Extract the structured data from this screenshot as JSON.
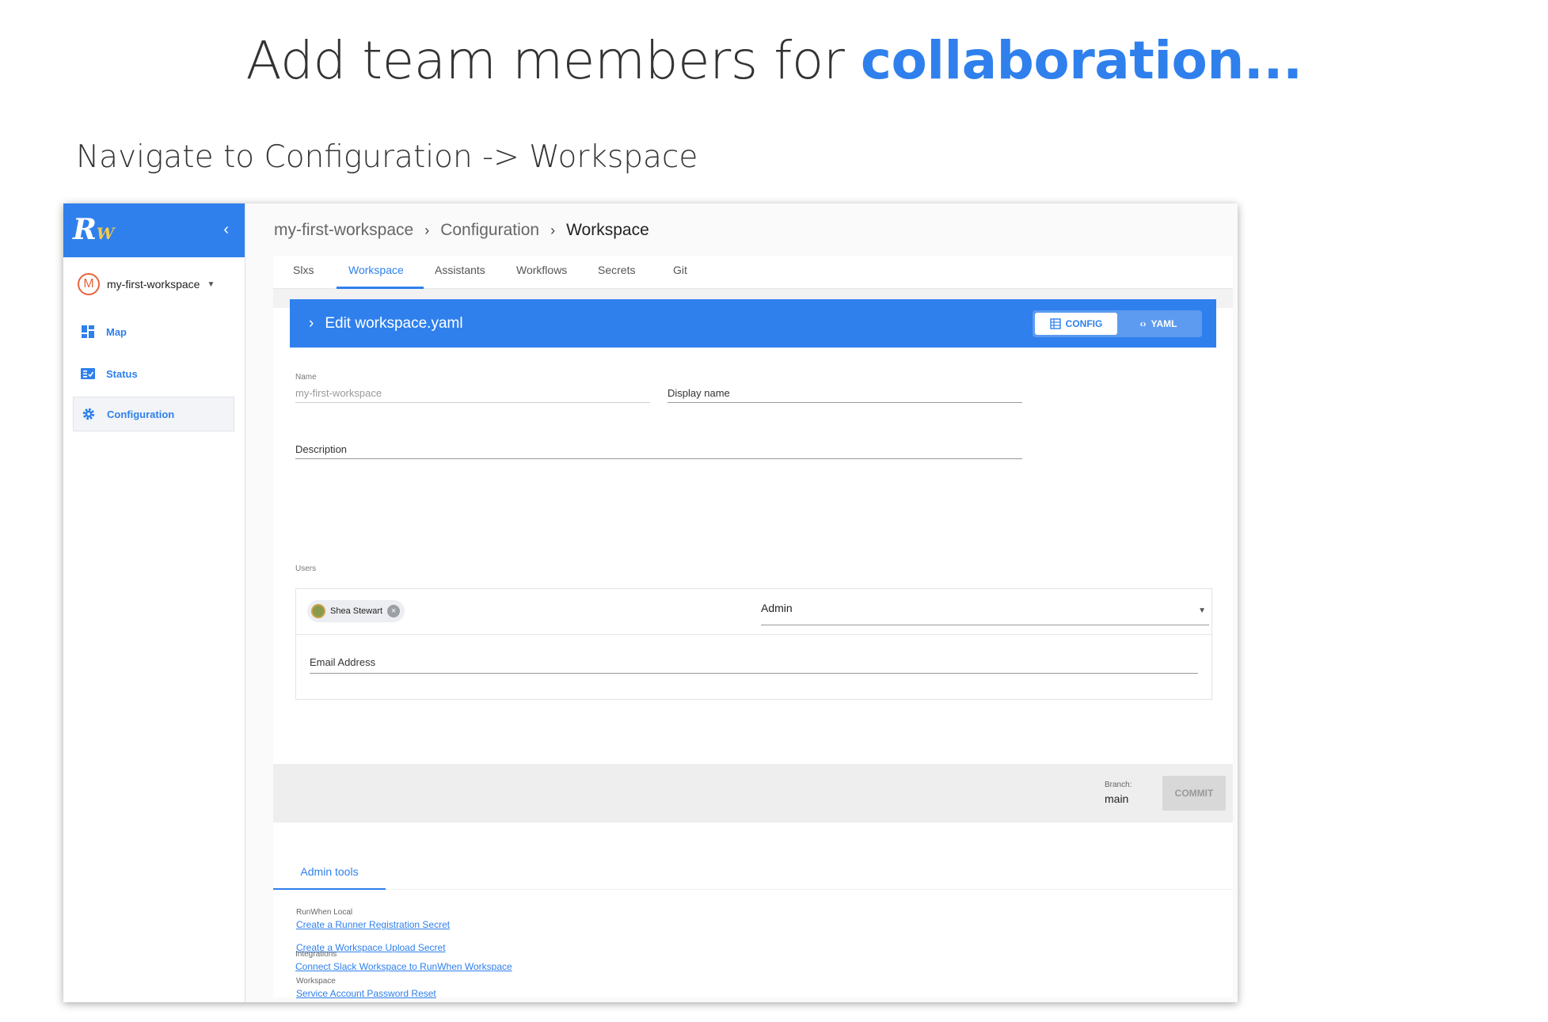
{
  "headline": {
    "prefix": "Add team members for ",
    "highlight": "collaboration..."
  },
  "subhead": "Navigate to Configuration -> Workspace",
  "app": {
    "logo": {
      "main": "R",
      "sub": "W"
    },
    "workspace_badge": "M",
    "workspace_name": "my-first-workspace",
    "nav": [
      {
        "label": "Map",
        "icon": "dashboard-icon"
      },
      {
        "label": "Status",
        "icon": "checklist-icon"
      },
      {
        "label": "Configuration",
        "icon": "gear-icon"
      }
    ],
    "breadcrumb": [
      "my-first-workspace",
      "Configuration",
      "Workspace"
    ],
    "tabs": [
      "Slxs",
      "Workspace",
      "Assistants",
      "Workflows",
      "Secrets",
      "Git"
    ],
    "active_tab": "Workspace",
    "editor": {
      "title": "Edit workspace.yaml",
      "toggle": {
        "config": "CONFIG",
        "yaml": "YAML"
      }
    },
    "form": {
      "name_label": "Name",
      "name_value": "my-first-workspace",
      "display_name_label": "Display name",
      "description_label": "Description",
      "users_label": "Users",
      "user_chip": "Shea Stewart",
      "role": "Admin",
      "email_label": "Email Address"
    },
    "commit_bar": {
      "branch_label": "Branch:",
      "branch": "main",
      "commit": "COMMIT"
    },
    "admin": {
      "tab": "Admin tools",
      "sections": [
        {
          "title": "RunWhen Local",
          "links": [
            "Create a Runner Registration Secret",
            "Create a Workspace Upload Secret"
          ]
        },
        {
          "title": "Workspace",
          "links": [
            "Service Account Password Reset"
          ]
        },
        {
          "title": "Integrations",
          "links": [
            "Connect Slack Workspace to RunWhen Workspace"
          ]
        }
      ]
    },
    "colors": {
      "primary": "#2f80ed",
      "badge": "#e8643c"
    }
  }
}
